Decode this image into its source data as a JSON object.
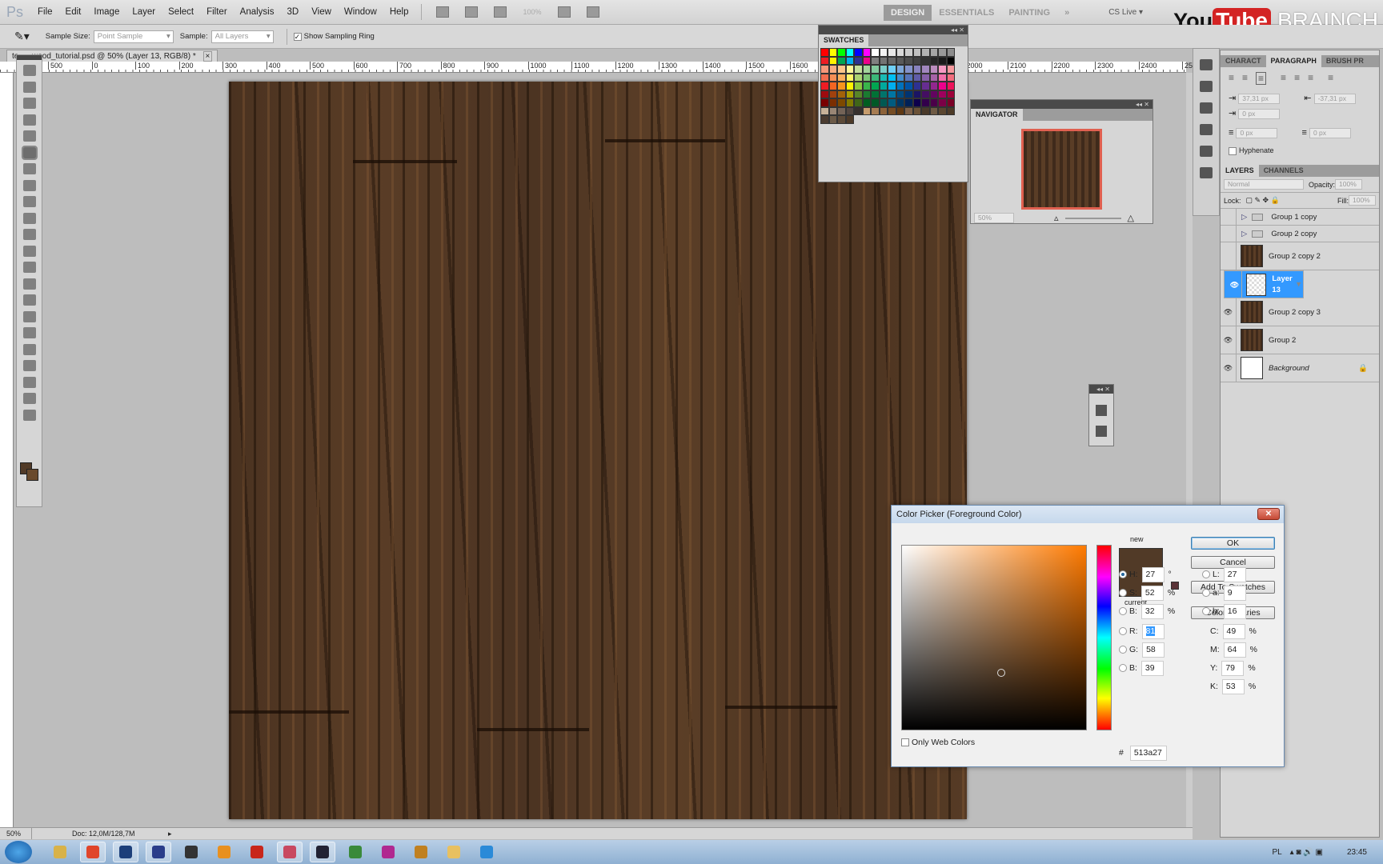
{
  "app": {
    "logo": "Ps",
    "menu": [
      "File",
      "Edit",
      "Image",
      "Layer",
      "Select",
      "Filter",
      "Analysis",
      "3D",
      "View",
      "Window",
      "Help"
    ],
    "zoom_display": "100%"
  },
  "workspaces": {
    "items": [
      "DESIGN",
      "ESSENTIALS",
      "PAINTING"
    ],
    "active": "DESIGN",
    "more": "»",
    "cs_live": "CS Live ▾"
  },
  "watermark": {
    "you": "You",
    "tube": "Tube",
    "brand": "BRAINCH"
  },
  "options": {
    "sample_size_label": "Sample Size:",
    "sample_size_value": "Point Sample",
    "sample_label": "Sample:",
    "sample_value": "All Layers",
    "show_ring": "Show Sampling Ring",
    "show_ring_checked": true
  },
  "document": {
    "tab_title": "te___wood_tutorial.psd @ 50% (Layer 13, RGB/8) *",
    "close": "×"
  },
  "ruler": {
    "top_ticks": [
      "500",
      "0",
      "100",
      "200",
      "300",
      "400",
      "500",
      "600",
      "700",
      "800",
      "900",
      "1000",
      "1100",
      "1200",
      "1300",
      "1400",
      "1500",
      "1600",
      "1700",
      "1800",
      "1900",
      "2000",
      "2100",
      "2200",
      "2300",
      "2400",
      "2500",
      "2600"
    ]
  },
  "status": {
    "zoom": "50%",
    "doc": "Doc: 12,0M/128,7M"
  },
  "colors": {
    "foreground": "#513a27",
    "background": "#6a4a2c",
    "selection": "#3399ff"
  },
  "swatches": {
    "title": "SWATCHES",
    "colors": [
      "#ff0000",
      "#ffff00",
      "#00ff00",
      "#00ffff",
      "#0000ff",
      "#ff00ff",
      "#ffffff",
      "#f2f2f2",
      "#e6e6e6",
      "#d9d9d9",
      "#cccccc",
      "#bfbfbf",
      "#b3b3b3",
      "#a6a6a6",
      "#999999",
      "#8c8c8c",
      "#ed1c24",
      "#fff200",
      "#00a651",
      "#00aeef",
      "#2e3192",
      "#ec008c",
      "#808080",
      "#737373",
      "#666666",
      "#595959",
      "#4d4d4d",
      "#404040",
      "#333333",
      "#262626",
      "#1a1a1a",
      "#000000",
      "#f7977a",
      "#f9ad81",
      "#fdc68a",
      "#fff79a",
      "#c4df9b",
      "#a3d39c",
      "#82ca9d",
      "#7bcdc8",
      "#6ecff6",
      "#7ea7d8",
      "#8493ca",
      "#8882be",
      "#a187be",
      "#bc8dbf",
      "#f49ac2",
      "#f6989d",
      "#f26c4f",
      "#f68e55",
      "#fbaf5c",
      "#fff467",
      "#acd372",
      "#7cc576",
      "#3bb878",
      "#1abbb4",
      "#00bff3",
      "#438ccb",
      "#5574b9",
      "#605ca8",
      "#855fa8",
      "#a763a8",
      "#f06ea9",
      "#f26d7d",
      "#ed1c24",
      "#f26522",
      "#f7941d",
      "#fff200",
      "#8dc73f",
      "#39b54a",
      "#00a651",
      "#00a99d",
      "#00aeef",
      "#0072bc",
      "#0054a6",
      "#2e3192",
      "#662d91",
      "#92278f",
      "#ec008c",
      "#ed145b",
      "#9e0b0f",
      "#a0410d",
      "#a36209",
      "#aba000",
      "#598527",
      "#1a7b30",
      "#007236",
      "#00746b",
      "#0076a3",
      "#004b80",
      "#003471",
      "#1b1464",
      "#440e62",
      "#630460",
      "#9e005d",
      "#9e0039",
      "#790000",
      "#7b2e00",
      "#7d4900",
      "#827b00",
      "#406618",
      "#005e20",
      "#005826",
      "#005952",
      "#005b7f",
      "#003663",
      "#002157",
      "#0d004c",
      "#32004b",
      "#4b0049",
      "#7b0046",
      "#7a0026",
      "#c7b299",
      "#998675",
      "#736357",
      "#534741",
      "#37302d",
      "#c69c6d",
      "#a67c52",
      "#8c6239",
      "#754c24",
      "#603913",
      "#7d6048",
      "#6b5237",
      "#4a3a2a",
      "#6e5a44",
      "#5a4630",
      "#4d3b28",
      "#4a3b30",
      "#6b5a48",
      "#5c4a38",
      "#4d3a28"
    ]
  },
  "navigator": {
    "title": "NAVIGATOR",
    "zoom": "50%"
  },
  "paragraph": {
    "tabs": [
      "CHARACT",
      "PARAGRAPH",
      "BRUSH PR"
    ],
    "active": "PARAGRAPH",
    "indent_left": "37,31 px",
    "indent_right": "-37,31 px",
    "first_line": "0 px",
    "space_before": "0 px",
    "space_after": "0 px",
    "hyphenate": "Hyphenate"
  },
  "layers": {
    "tabs": [
      "LAYERS",
      "CHANNELS"
    ],
    "active": "LAYERS",
    "blend": "Normal",
    "opacity_label": "Opacity:",
    "opacity": "100%",
    "lock_label": "Lock:",
    "fill_label": "Fill:",
    "fill": "100%",
    "items": [
      {
        "name": "Group 1 copy",
        "type": "group",
        "visible": false
      },
      {
        "name": "Group 2 copy",
        "type": "group",
        "visible": false
      },
      {
        "name": "Group 2 copy 2",
        "type": "layer",
        "visible": false
      },
      {
        "name": "Layer 13",
        "type": "layer",
        "visible": true,
        "selected": true
      },
      {
        "name": "Group 2 copy 3",
        "type": "layer",
        "visible": true
      },
      {
        "name": "Group 2",
        "type": "layer",
        "visible": true
      },
      {
        "name": "Background",
        "type": "background",
        "visible": true,
        "locked": true
      }
    ]
  },
  "picker": {
    "title": "Color Picker (Foreground Color)",
    "ok": "OK",
    "cancel": "Cancel",
    "add": "Add To Swatches",
    "libraries": "Color Libraries",
    "new_label": "new",
    "current_label": "current",
    "only_web": "Only Web Colors",
    "H": "27",
    "S": "52",
    "Bv": "32",
    "R": "81",
    "G": "58",
    "B": "39",
    "L": "27",
    "a": "9",
    "b": "16",
    "C": "49",
    "M": "64",
    "Y": "79",
    "K": "53",
    "hex": "513a27",
    "deg": "°",
    "pct": "%",
    "hash": "#"
  },
  "taskbar": {
    "apps": [
      "explorer",
      "chrome",
      "photoshop",
      "save",
      "unity",
      "app",
      "acrobat",
      "app2",
      "app3",
      "app4",
      "photoshop-cs",
      "app5",
      "app6",
      "skype"
    ],
    "lang": "PL",
    "time": "23:45"
  }
}
